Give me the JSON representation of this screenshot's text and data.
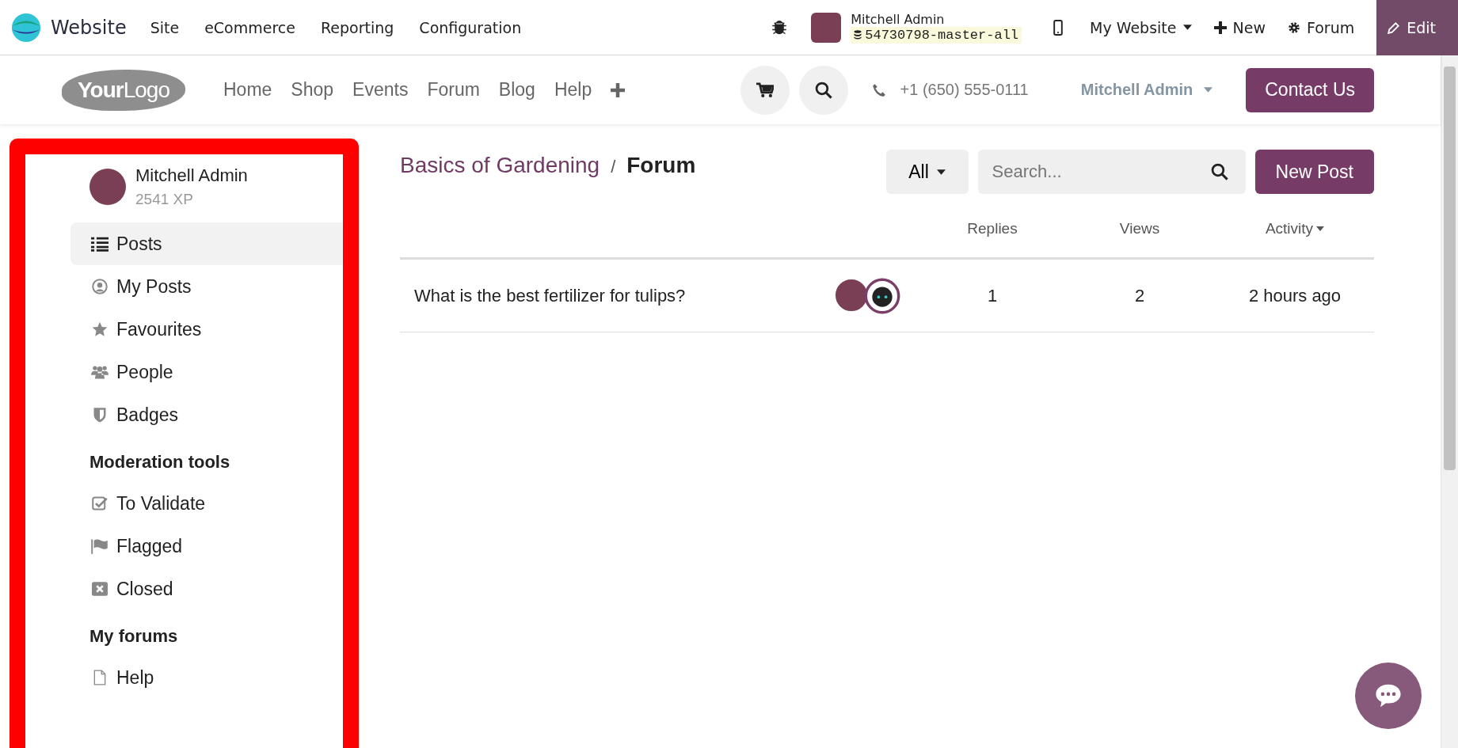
{
  "admin_bar": {
    "app": "Website",
    "menu": [
      "Site",
      "eCommerce",
      "Reporting",
      "Configuration"
    ],
    "user": {
      "name": "Mitchell Admin",
      "database": "54730798-master-all"
    },
    "website_switcher": "My Website",
    "new": "New",
    "forum": "Forum",
    "edit": "Edit"
  },
  "header": {
    "logo": "**Your**Logo",
    "nav": [
      "Home",
      "Shop",
      "Events",
      "Forum",
      "Blog",
      "Help"
    ],
    "phone": "+1 (650) 555-0111",
    "user": "Mitchell Admin",
    "contact": "Contact Us"
  },
  "sidebar": {
    "user": {
      "name": "Mitchell Admin",
      "xp": "2541 XP"
    },
    "items": [
      {
        "label": "Posts",
        "kind": "list",
        "selected": true
      },
      {
        "label": "My Posts",
        "kind": "user",
        "selected": false
      },
      {
        "label": "Favourites",
        "kind": "star",
        "selected": false
      },
      {
        "label": "People",
        "kind": "people",
        "selected": false
      },
      {
        "label": "Badges",
        "kind": "badge",
        "selected": false
      }
    ],
    "sections": [
      {
        "title": "Moderation tools",
        "items": [
          {
            "label": "To Validate",
            "kind": "check",
            "selected": false
          },
          {
            "label": "Flagged",
            "kind": "flag",
            "selected": false
          },
          {
            "label": "Closed",
            "kind": "close",
            "selected": false
          }
        ]
      },
      {
        "title": "My forums",
        "items": [
          {
            "label": "Help",
            "kind": "file",
            "selected": false
          }
        ]
      }
    ]
  },
  "breadcrumb": {
    "parent": "Basics of Gardening",
    "separator": "/",
    "current": "Forum"
  },
  "filter": "All",
  "search": {
    "placeholder": "Search..."
  },
  "new_post": "New Post",
  "table": {
    "columns": [
      "Replies",
      "Views",
      "Activity"
    ],
    "rows": [
      {
        "title": "What is the best fertilizer for tulips?",
        "replies": "1",
        "views": "2",
        "activity": "2 hours ago"
      }
    ]
  }
}
